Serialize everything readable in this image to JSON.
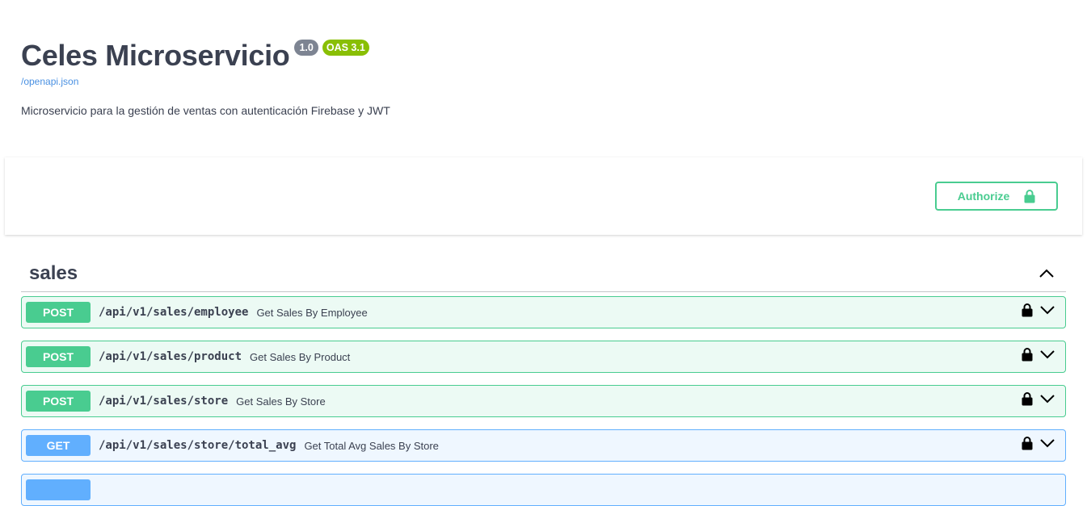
{
  "info": {
    "title": "Celes Microservicio",
    "version_badge": "1.0",
    "oas_badge": "OAS 3.1",
    "spec_link": "/openapi.json",
    "description": "Microservicio para la gestión de ventas con autenticación Firebase y JWT"
  },
  "auth": {
    "authorize_label": "Authorize",
    "lock_icon": "lock-icon"
  },
  "tag": {
    "name": "sales",
    "toggle_icon": "chevron-up-icon"
  },
  "colors": {
    "post": "#49cc90",
    "get": "#61affe",
    "oas": "#89bf04",
    "version": "#7d8492"
  },
  "operations": [
    {
      "method": "POST",
      "path": "/api/v1/sales/employee",
      "summary": "Get Sales By Employee"
    },
    {
      "method": "POST",
      "path": "/api/v1/sales/product",
      "summary": "Get Sales By Product"
    },
    {
      "method": "POST",
      "path": "/api/v1/sales/store",
      "summary": "Get Sales By Store"
    },
    {
      "method": "GET",
      "path": "/api/v1/sales/store/total_avg",
      "summary": "Get Total Avg Sales By Store"
    }
  ]
}
